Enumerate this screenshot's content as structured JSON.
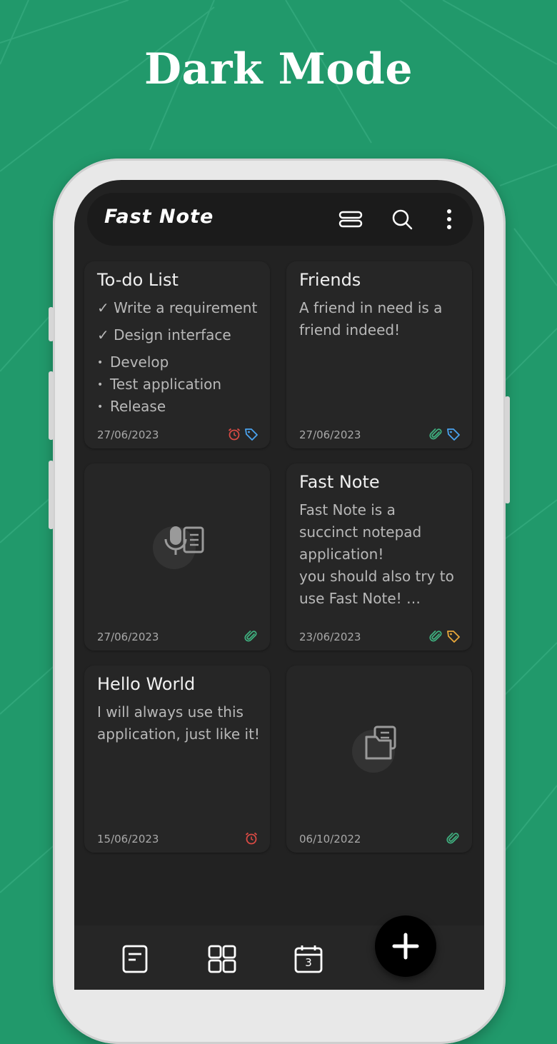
{
  "headline": "Dark Mode",
  "app": {
    "title": "Fast Note",
    "icons": [
      "layout-toggle-icon",
      "search-icon",
      "more-vert-icon"
    ]
  },
  "notes": [
    {
      "title": "To-do List",
      "items": [
        {
          "mark": "✓",
          "text": "Write a requirement"
        },
        {
          "mark": "✓",
          "text": "Design interface"
        },
        {
          "mark": "•",
          "text": "Develop"
        },
        {
          "mark": "•",
          "text": "Test application"
        },
        {
          "mark": "•",
          "text": "Release"
        }
      ],
      "date": "27/06/2023",
      "icons": [
        "alarm-icon",
        "tag-icon"
      ]
    },
    {
      "title": "Friends",
      "body": "A friend in need is a friend indeed!",
      "date": "27/06/2023",
      "icons": [
        "attachment-icon",
        "tag-icon"
      ]
    },
    {
      "title": "",
      "media": "voice-note-icon",
      "date": "27/06/2023",
      "icons": [
        "attachment-icon"
      ]
    },
    {
      "title": "Fast Note",
      "body_lines": [
        "Fast Note is a",
        "succinct notepad",
        "application!",
        "you should also try to",
        "use Fast Note!  …"
      ],
      "date": "23/06/2023",
      "icons": [
        "attachment-icon",
        "tag-icon"
      ]
    },
    {
      "title": "Hello World",
      "body": "I will always use this application, just like it!",
      "date": "15/06/2023",
      "icons": [
        "alarm-icon"
      ]
    },
    {
      "title": "",
      "media": "folder-files-icon",
      "date": "06/10/2022",
      "icons": [
        "attachment-icon"
      ]
    }
  ],
  "bottom_nav": {
    "items": [
      "notes-icon",
      "grid-icon",
      "calendar-icon"
    ],
    "calendar_day": "3",
    "fab": "add-icon"
  },
  "colors": {
    "background": "#21996b",
    "alarm": "#d94a44",
    "tag_blue": "#4aa3f0",
    "tag_orange": "#e8a73a",
    "attachment": "#3fae7e"
  }
}
